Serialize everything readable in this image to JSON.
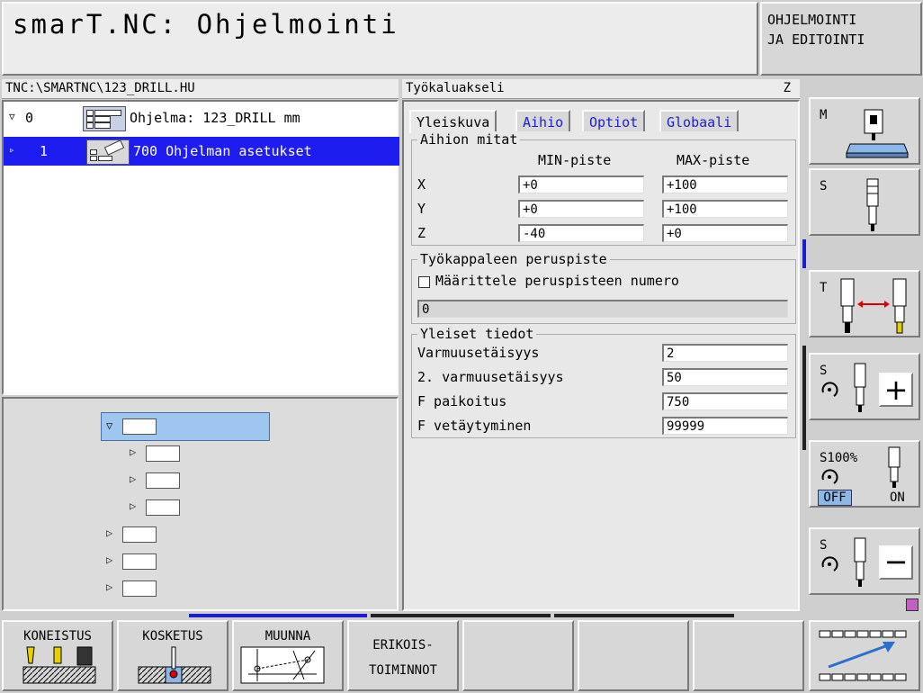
{
  "app": {
    "title": "smarT.NC: Ohjelmointi",
    "mode_line1": "OHJELMOINTI",
    "mode_line2": "JA EDITOINTI"
  },
  "program": {
    "path": "TNC:\\SMARTNC\\123_DRILL.HU"
  },
  "tree": {
    "rows": [
      {
        "toggle": "▽",
        "num": "0",
        "text": "Ohjelma: 123_DRILL mm"
      },
      {
        "toggle": "▹",
        "num": "1",
        "text": "700 Ohjelman asetukset"
      }
    ]
  },
  "form": {
    "header": "Työkaluakseli",
    "axis": "Z",
    "tabs": [
      "Yleiskuva",
      "Aihio",
      "Optiot",
      "Globaali"
    ],
    "blank": {
      "title": "Aihion mitat",
      "min_header": "MIN-piste",
      "max_header": "MAX-piste",
      "rows": [
        {
          "axis": "X",
          "min": "+0",
          "max": "+100"
        },
        {
          "axis": "Y",
          "min": "+0",
          "max": "+100"
        },
        {
          "axis": "Z",
          "min": "-40",
          "max": "+0"
        }
      ]
    },
    "datum": {
      "title": "Työkappaleen peruspiste",
      "checkbox_label": "Määrittele peruspisteen numero",
      "value": "0"
    },
    "general": {
      "title": "Yleiset tiedot",
      "rows": [
        {
          "label": "Varmuusetäisyys",
          "value": "2"
        },
        {
          "label": "2. varmuusetäisyys",
          "value": "50"
        },
        {
          "label": "F paikoitus",
          "value": "750"
        },
        {
          "label": "F vetäytyminen",
          "value": "99999"
        }
      ]
    }
  },
  "vertical_softkeys": {
    "m": "M",
    "s": "S",
    "t": "T",
    "s_plus": "S",
    "s100": "S100%",
    "off": "OFF",
    "on": "ON",
    "s_minus": "S"
  },
  "bottom_softkeys": {
    "machining": "KONEISTUS",
    "probing": "KOSKETUS",
    "convert": "MUUNNA",
    "special_1": "ERIKOIS-",
    "special_2": "TOIMINNOT"
  },
  "colors": {
    "selection": "#1d1df0",
    "accent_blue": "#1d1dd0",
    "arrow_red": "#e00000",
    "tool_yellow": "#e8d000"
  }
}
